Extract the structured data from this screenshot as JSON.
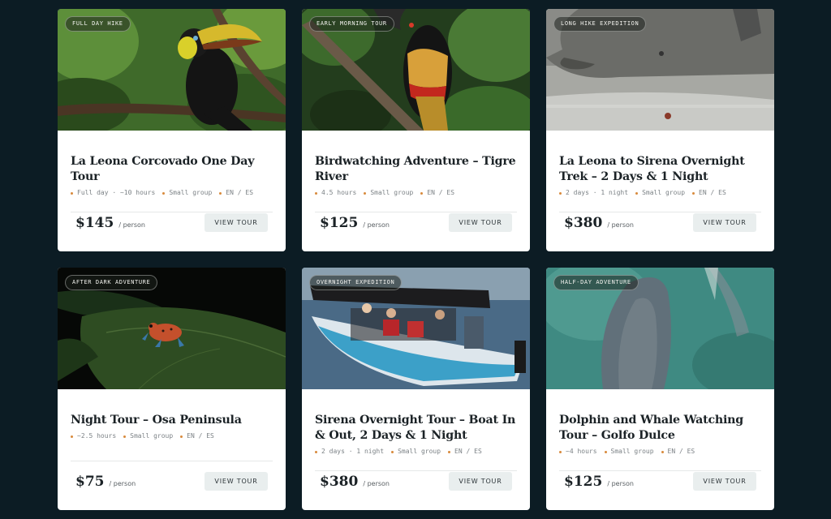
{
  "tours": [
    {
      "badge": "FULL DAY HIKE",
      "title": "La Leona Corcovado One Day Tour",
      "meta": [
        "Full day · ~10 hours",
        "Small group",
        "EN / ES"
      ],
      "price": "$145",
      "per": "/ person",
      "cta": "VIEW TOUR",
      "image": "toucan-image"
    },
    {
      "badge": "EARLY MORNING TOUR",
      "title": "Birdwatching Adventure – Tigre River",
      "meta": [
        "4.5 hours",
        "Small group",
        "EN / ES"
      ],
      "price": "$125",
      "per": "/ person",
      "cta": "VIEW TOUR",
      "image": "aracari-image"
    },
    {
      "badge": "LONG HIKE EXPEDITION",
      "title": "La Leona to Sirena Overnight Trek – 2 Days & 1 Night",
      "meta": [
        "2 days · 1 night",
        "Small group",
        "EN / ES"
      ],
      "price": "$380",
      "per": "/ person",
      "cta": "VIEW TOUR",
      "image": "tapir-image"
    },
    {
      "badge": "AFTER DARK ADVENTURE",
      "title": "Night Tour – Osa Peninsula",
      "meta": [
        "~2.5 hours",
        "Small group",
        "EN / ES"
      ],
      "price": "$75",
      "per": "/ person",
      "cta": "VIEW TOUR",
      "image": "frog-image"
    },
    {
      "badge": "OVERNIGHT EXPEDITION",
      "title": "Sirena Overnight Tour – Boat In & Out, 2 Days & 1 Night",
      "meta": [
        "2 days · 1 night",
        "Small group",
        "EN / ES"
      ],
      "price": "$380",
      "per": "/ person",
      "cta": "VIEW TOUR",
      "image": "boat-image"
    },
    {
      "badge": "HALF-DAY ADVENTURE",
      "title": "Dolphin and Whale Watching Tour – Golfo Dulce",
      "meta": [
        "~4 hours",
        "Small group",
        "EN / ES"
      ],
      "price": "$125",
      "per": "/ person",
      "cta": "VIEW TOUR",
      "image": "whale-image"
    }
  ],
  "colors": {
    "background": "#0c1c24",
    "card": "#ffffff",
    "accent_dot": "#d88a3c",
    "button_bg": "#e9eeee"
  }
}
